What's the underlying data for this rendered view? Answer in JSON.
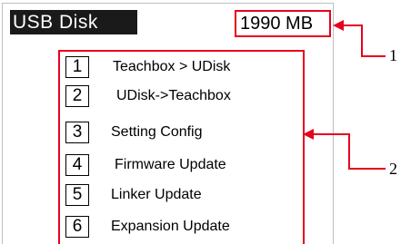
{
  "header": {
    "title": "USB Disk",
    "disk_size": "1990 MB"
  },
  "menu": {
    "items": [
      {
        "num": "1",
        "label": "Teachbox >   UDisk"
      },
      {
        "num": "2",
        "label": "UDisk->Teachbox"
      },
      {
        "num": "3",
        "label": "Setting Config"
      },
      {
        "num": "4",
        "label": "Firmware Update"
      },
      {
        "num": "5",
        "label": "Linker Update"
      },
      {
        "num": "6",
        "label": "Expansion Update"
      }
    ]
  },
  "callouts": {
    "first": "1",
    "second": "2"
  },
  "colors": {
    "highlight": "#e8001c",
    "title_bg": "#1a1a1a"
  }
}
